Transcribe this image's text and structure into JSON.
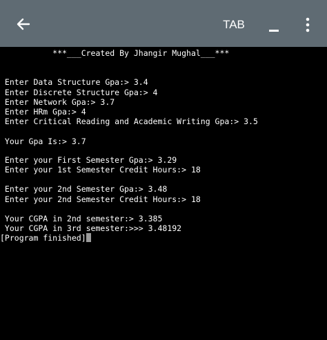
{
  "toolbar": {
    "back_icon": "arrow-left-icon",
    "tab_label": "TAB",
    "menu_icon": "more-vertical-icon",
    "bar_color": "#5f6b73"
  },
  "terminal": {
    "background": "#000000",
    "text_color": "#ffffff",
    "lines": [
      "           ***___Created By Jhangir Mughal___***",
      "",
      "",
      " Enter Data Structure Gpa:> 3.4",
      " Enter Discrete Structure Gpa:> 4",
      " Enter Network Gpa:> 3.7",
      " Enter HRm Gpa:> 4",
      " Enter Critical Reading and Academic Writing Gpa:> 3.5",
      "",
      " Your Gpa Is:> 3.7",
      "",
      " Enter your First Semester Gpa:> 3.29",
      " Enter your 1st Semester Credit Hours:> 18",
      "",
      " Enter your 2nd Semester Gpa:> 3.48",
      " Enter your 2nd Semester Credit Hours:> 18",
      "",
      " Your CGPA in 2nd semester:> 3.385",
      " Your CGPA in 3rd semester:>>> 3.48192",
      "[Program finished]"
    ]
  }
}
